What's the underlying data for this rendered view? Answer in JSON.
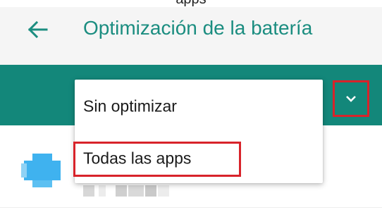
{
  "top_cutoff_text": "apps",
  "header": {
    "back_icon": "arrow-back-icon",
    "title": "Optimización de la batería"
  },
  "filter_bar": {
    "dropdown_icon": "chevron-down-icon"
  },
  "menu": {
    "items": [
      {
        "label": "Sin optimizar"
      },
      {
        "label": "Todas las apps"
      }
    ]
  },
  "list": {
    "first_app_icon": "app-icon"
  },
  "colors": {
    "accent": "#13877a",
    "title_text": "#1b8d80",
    "highlight": "#d8232a"
  }
}
